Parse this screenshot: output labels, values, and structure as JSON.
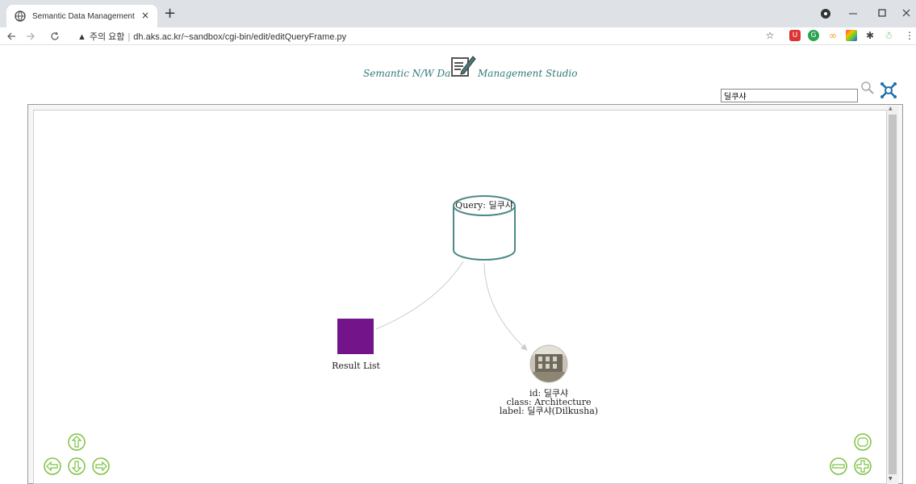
{
  "browser": {
    "tab_title": "Semantic Data Management St",
    "tab_close": "×",
    "new_tab": "+",
    "url_warning": "주의 요함",
    "url_separator": "|",
    "url": "dh.aks.ac.kr/~sandbox/cgi-bin/edit/editQueryFrame.py"
  },
  "header": {
    "title_left": "Semantic N/W Data",
    "title_right": "Management Studio"
  },
  "search": {
    "value": "딜쿠샤"
  },
  "graph": {
    "query_node_label": "Query: 딜쿠샤",
    "result_node_label": "Result List",
    "result_node_color": "#74148a",
    "entity": {
      "id_line": "id: 딜쿠샤",
      "class_line": "class: Architecture",
      "label_line": "label: 딜쿠샤(Dilkusha)"
    },
    "edge_color": "#cccccc",
    "node_stroke_color": "#4b8a88"
  },
  "controls": {
    "accent_color": "#7cc242",
    "icons": [
      "pan-up-icon",
      "pan-left-icon",
      "pan-down-icon",
      "pan-right-icon",
      "reset-view-icon",
      "zoom-out-icon",
      "zoom-in-icon"
    ]
  }
}
